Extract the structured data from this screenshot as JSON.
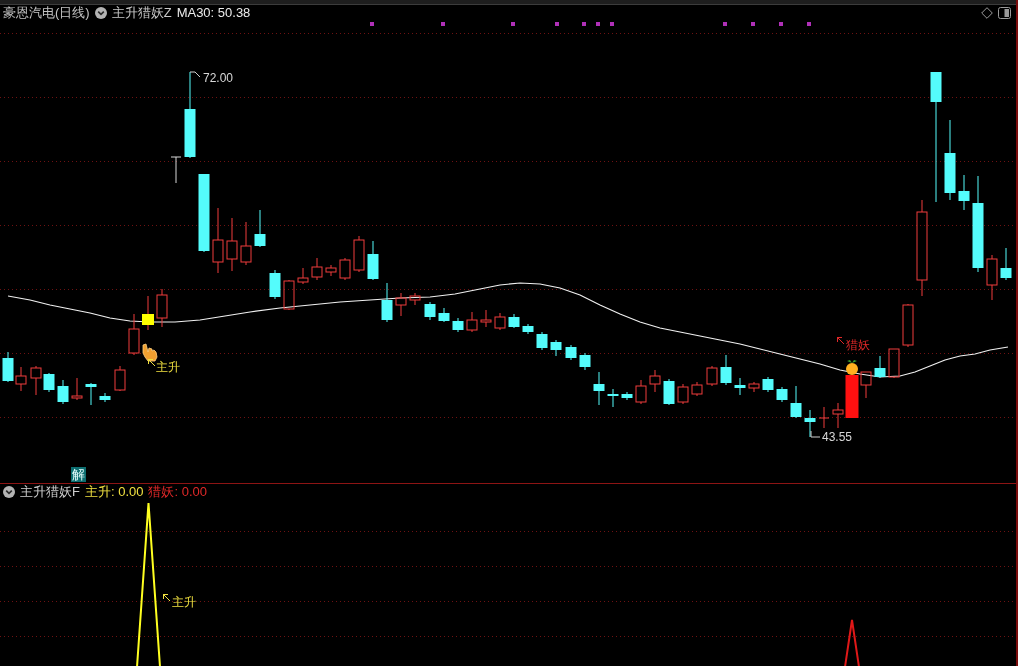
{
  "main_panel": {
    "stock_title": "豪恩汽电(日线)",
    "indicator_name": "主升猎妖Z",
    "ma_reading": "MA30: 50.38",
    "annotations": [
      {
        "kind": "high",
        "text": "72.00"
      },
      {
        "kind": "signal",
        "text": "主升",
        "color": "#f0e040"
      },
      {
        "kind": "signal",
        "text": "猎妖",
        "color": "#e02828"
      },
      {
        "kind": "low",
        "text": "43.55"
      }
    ],
    "badge": "解"
  },
  "sub_panel": {
    "indicator_name": "主升猎妖F",
    "readings": [
      {
        "text": "主升: 0.00",
        "color": "#f0e040"
      },
      {
        "text": "猎妖: 0.00",
        "color": "#e02828"
      }
    ],
    "spike_label": "主升"
  }
}
